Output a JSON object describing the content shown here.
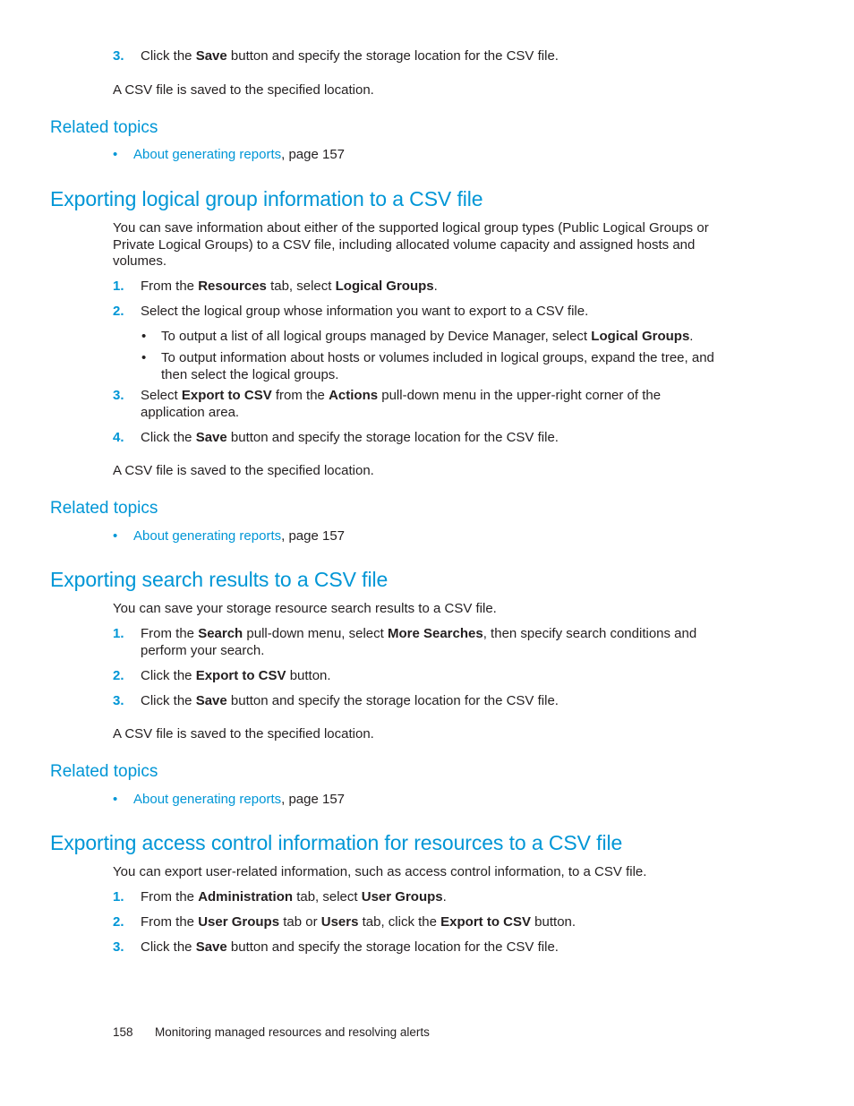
{
  "top": {
    "step3": {
      "num": "3.",
      "pre": "Click the ",
      "bold": "Save",
      "post": " button and specify the storage location for the CSV file."
    },
    "result": "A CSV file is saved to the specified location.",
    "related_heading": "Related topics",
    "related_link": {
      "bullet": "•",
      "link": "About generating reports",
      "suffix": ", page 157"
    }
  },
  "sections": [
    {
      "title": "Exporting logical group information to a CSV file",
      "intro": "You can save information about either of the supported logical group types (Public Logical Groups or Private Logical Groups) to a CSV file, including allocated volume capacity and assigned hosts and volumes.",
      "steps": [
        {
          "num": "1.",
          "p1": "From the ",
          "b1": "Resources",
          "p2": " tab, select ",
          "b2": "Logical Groups",
          "p3": "."
        },
        {
          "num": "2.",
          "text": "Select the logical group whose information you want to export to a CSV file."
        },
        {
          "num": "3.",
          "p1": "Select ",
          "b1": "Export to CSV",
          "p2": " from the ",
          "b2": "Actions",
          "p3": " pull-down menu in the upper-right corner of the application area."
        },
        {
          "num": "4.",
          "p1": "Click the ",
          "b1": "Save",
          "p2": " button and specify the storage location for the CSV file."
        }
      ],
      "bullets": [
        {
          "dot": "•",
          "p1": "To output a list of all logical groups managed by Device Manager, select ",
          "b1": "Logical Groups",
          "p2": "."
        },
        {
          "dot": "•",
          "text": "To output information about hosts or volumes included in logical groups, expand the tree, and then select the logical groups."
        }
      ],
      "result": "A CSV file is saved to the specified location.",
      "related_heading": "Related topics",
      "related_link": {
        "bullet": "•",
        "link": "About generating reports",
        "suffix": ", page 157"
      }
    },
    {
      "title": "Exporting search results to a CSV file",
      "intro": "You can save your storage resource search results to a CSV file.",
      "steps": [
        {
          "num": "1.",
          "p1": "From the ",
          "b1": "Search",
          "p2": " pull-down menu, select ",
          "b2": "More Searches",
          "p3": ", then specify search conditions and perform your search."
        },
        {
          "num": "2.",
          "p1": "Click the ",
          "b1": "Export to CSV",
          "p2": " button."
        },
        {
          "num": "3.",
          "p1": "Click the ",
          "b1": "Save",
          "p2": " button and specify the storage location for the CSV file."
        }
      ],
      "result": "A CSV file is saved to the specified location.",
      "related_heading": "Related topics",
      "related_link": {
        "bullet": "•",
        "link": "About generating reports",
        "suffix": ", page 157"
      }
    },
    {
      "title": "Exporting access control information for resources to a CSV file",
      "intro": "You can export user-related information, such as access control information, to a CSV file.",
      "steps": [
        {
          "num": "1.",
          "p1": "From the ",
          "b1": "Administration",
          "p2": " tab, select ",
          "b2": "User Groups",
          "p3": "."
        },
        {
          "num": "2.",
          "p1": "From the ",
          "b1": "User Groups",
          "p2": " tab or ",
          "b2": "Users",
          "p3": " tab, click the ",
          "b3": "Export to CSV",
          "p4": " button."
        },
        {
          "num": "3.",
          "p1": "Click the ",
          "b1": "Save",
          "p2": " button and specify the storage location for the CSV file."
        }
      ]
    }
  ],
  "footer": {
    "page_number": "158",
    "chapter": "Monitoring managed resources and resolving alerts"
  }
}
